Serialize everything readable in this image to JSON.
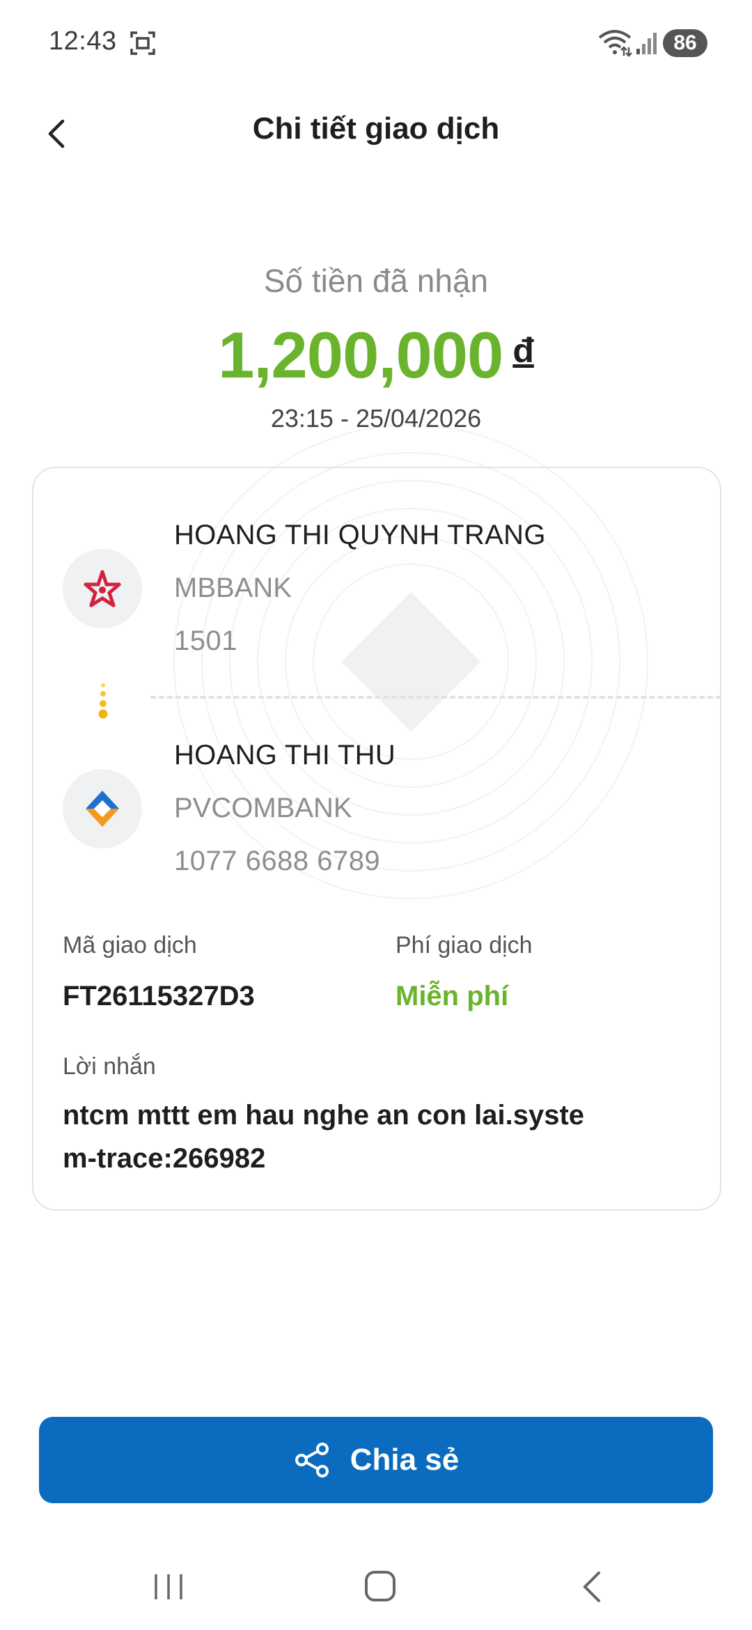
{
  "status_bar": {
    "time": "12:43",
    "battery": "86",
    "icons": [
      "screenshot-icon",
      "wifi-icon",
      "signal-icon"
    ]
  },
  "header": {
    "title": "Chi tiết giao dịch",
    "back_icon": "chevron-left-icon"
  },
  "summary": {
    "label": "Số tiền đã nhận",
    "amount": "1,200,000",
    "currency": "đ",
    "timestamp": "23:15 - 25/04/2026",
    "amount_color": "#6ab42d"
  },
  "sender": {
    "name": "HOANG THI QUYNH TRANG",
    "bank": "MBBANK",
    "account": "1501",
    "logo_icon": "mbbank-star-icon",
    "logo_color": "#d4213d"
  },
  "receiver": {
    "name": "HOANG THI THU",
    "bank": "PVCOMBANK",
    "account": "1077 6688 6789",
    "logo_icon": "pvcombank-logo-icon"
  },
  "details": {
    "transaction_id_label": "Mã giao dịch",
    "transaction_id": "FT26115327D3",
    "fee_label": "Phí giao dịch",
    "fee_value": "Miễn phí",
    "message_label": "Lời nhắn",
    "message": "ntcm mttt em hau nghe an con lai.system-trace:266982"
  },
  "actions": {
    "share_label": "Chia sẻ",
    "share_icon": "share-icon",
    "button_color": "#0b6cbf"
  },
  "nav_bar": {
    "icons": [
      "recent-apps-icon",
      "home-icon",
      "back-nav-icon"
    ]
  }
}
